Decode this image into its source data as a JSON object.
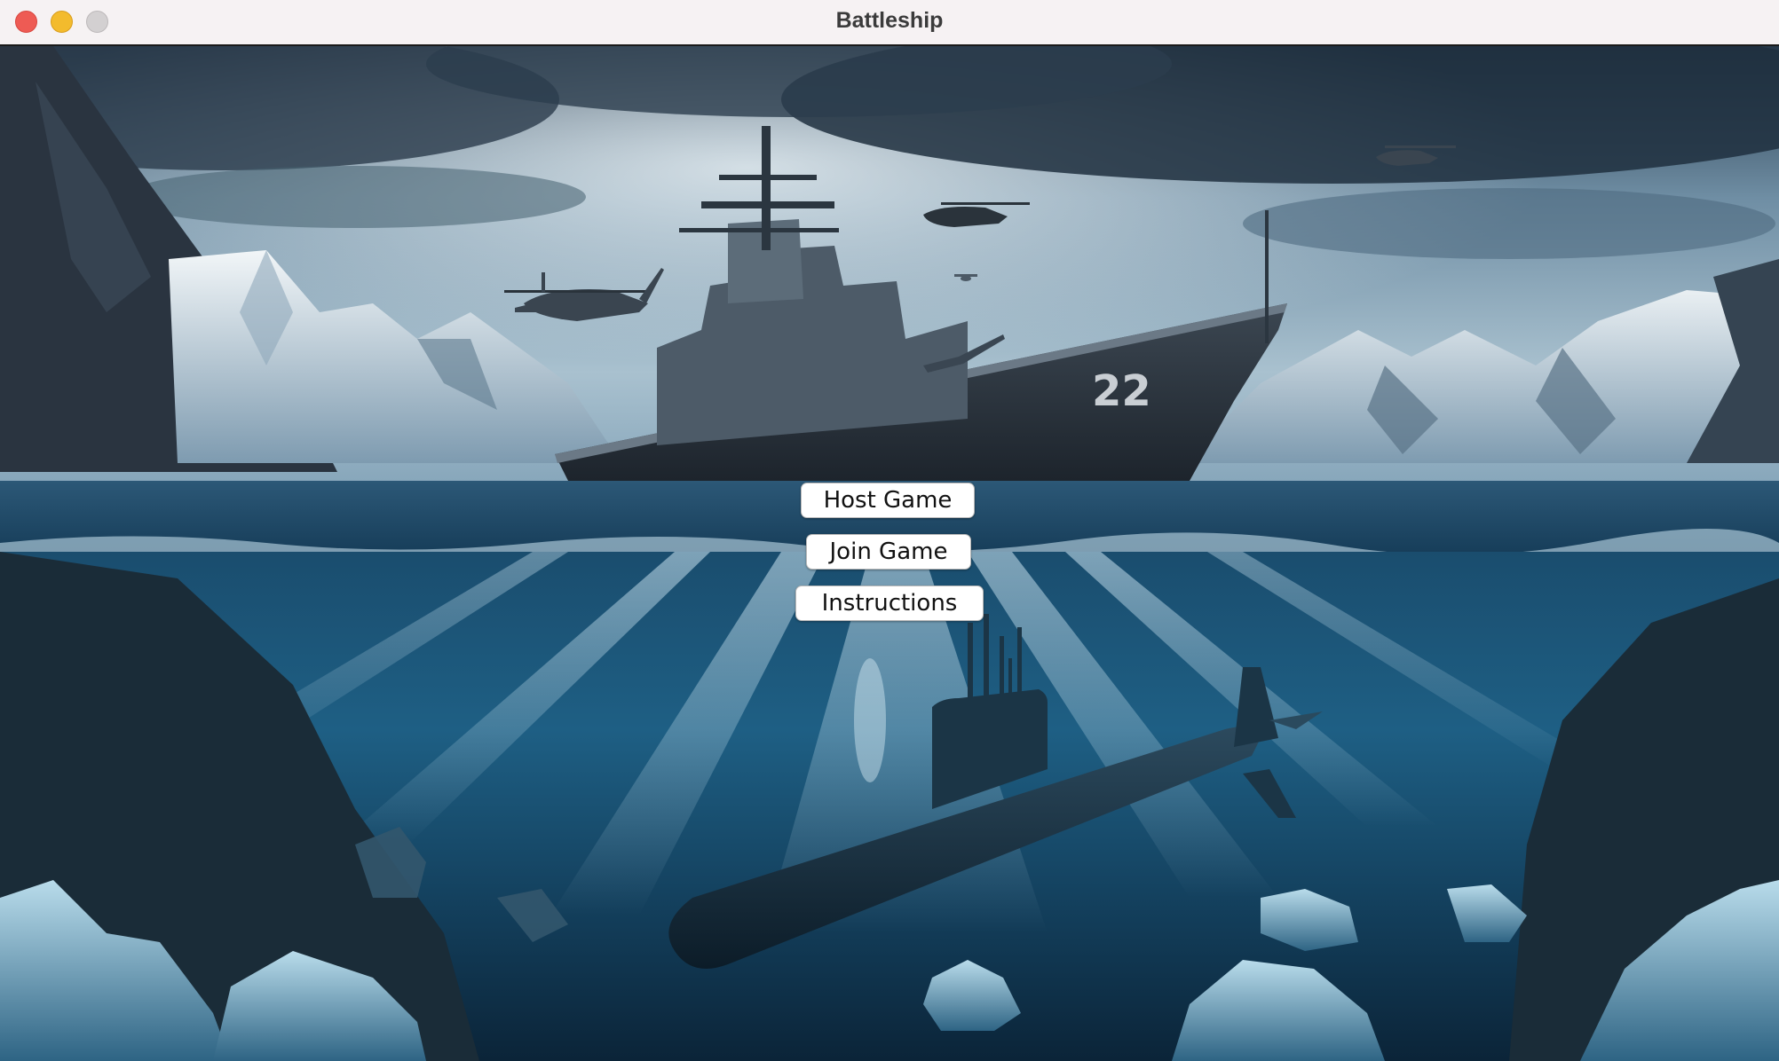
{
  "window": {
    "title": "Battleship",
    "controls": [
      "close",
      "minimize",
      "maximize"
    ]
  },
  "menu": {
    "host_label": "Host Game",
    "join_label": "Join Game",
    "instructions_label": "Instructions"
  },
  "background": {
    "ship_hull_number": "22"
  },
  "colors": {
    "close": "#ee5b54",
    "minimize": "#f3bb2d",
    "maximize": "#d3d0d1",
    "sky": "#8aa5b8",
    "water": "#1f5a7c"
  }
}
